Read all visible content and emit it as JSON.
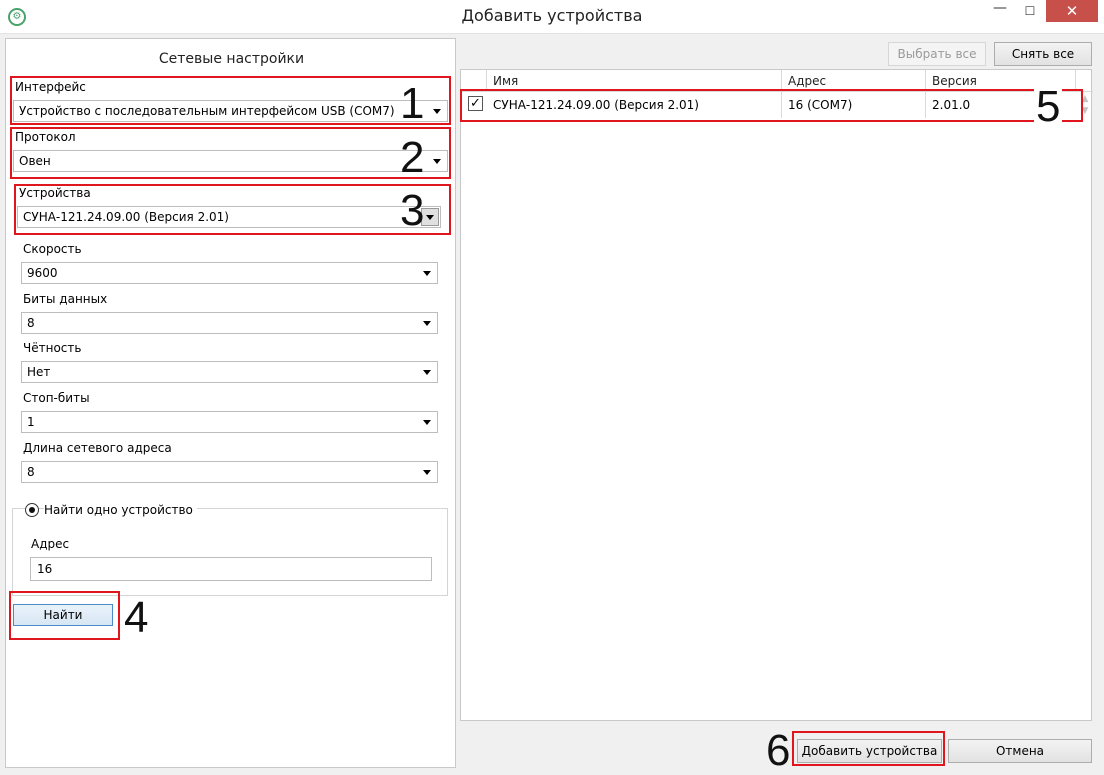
{
  "window": {
    "title": "Добавить устройства",
    "close_glyph": "✕",
    "min_glyph": "—",
    "max_glyph": "☐",
    "app_icon_glyph": "⚙"
  },
  "left": {
    "section_title": "Сетевые настройки",
    "interface": {
      "label": "Интерфейс",
      "value": "Устройство с последовательным интерфейсом USB (COM7)"
    },
    "protocol": {
      "label": "Протокол",
      "value": "Овен"
    },
    "devices": {
      "label": "Устройства",
      "value": "СУНА-121.24.09.00 (Версия 2.01)"
    },
    "speed": {
      "label": "Скорость",
      "value": "9600"
    },
    "data_bits": {
      "label": "Биты данных",
      "value": "8"
    },
    "parity": {
      "label": "Чётность",
      "value": "Нет"
    },
    "stop_bits": {
      "label": "Стоп-биты",
      "value": "1"
    },
    "address_length": {
      "label": "Длина сетевого адреса",
      "value": "8"
    },
    "find_one": {
      "label": "Найти одно устройство"
    },
    "address": {
      "label": "Адрес",
      "value": "16"
    },
    "find_button": "Найти"
  },
  "right": {
    "select_all": "Выбрать все",
    "clear_all": "Снять все",
    "columns": [
      "Имя",
      "Адрес",
      "Версия"
    ],
    "rows": [
      {
        "checked": "✓",
        "name": "СУНА-121.24.09.00 (Версия 2.01)",
        "address": "16 (COM7)",
        "version": "2.01.0"
      }
    ]
  },
  "footer": {
    "add_button": "Добавить устройства",
    "cancel_button": "Отмена"
  },
  "annotations": [
    "1",
    "2",
    "3",
    "4",
    "5",
    "6"
  ],
  "colors": {
    "highlight": "#e0161c",
    "close": "#c7504b",
    "accent": "#4a8bc9"
  }
}
